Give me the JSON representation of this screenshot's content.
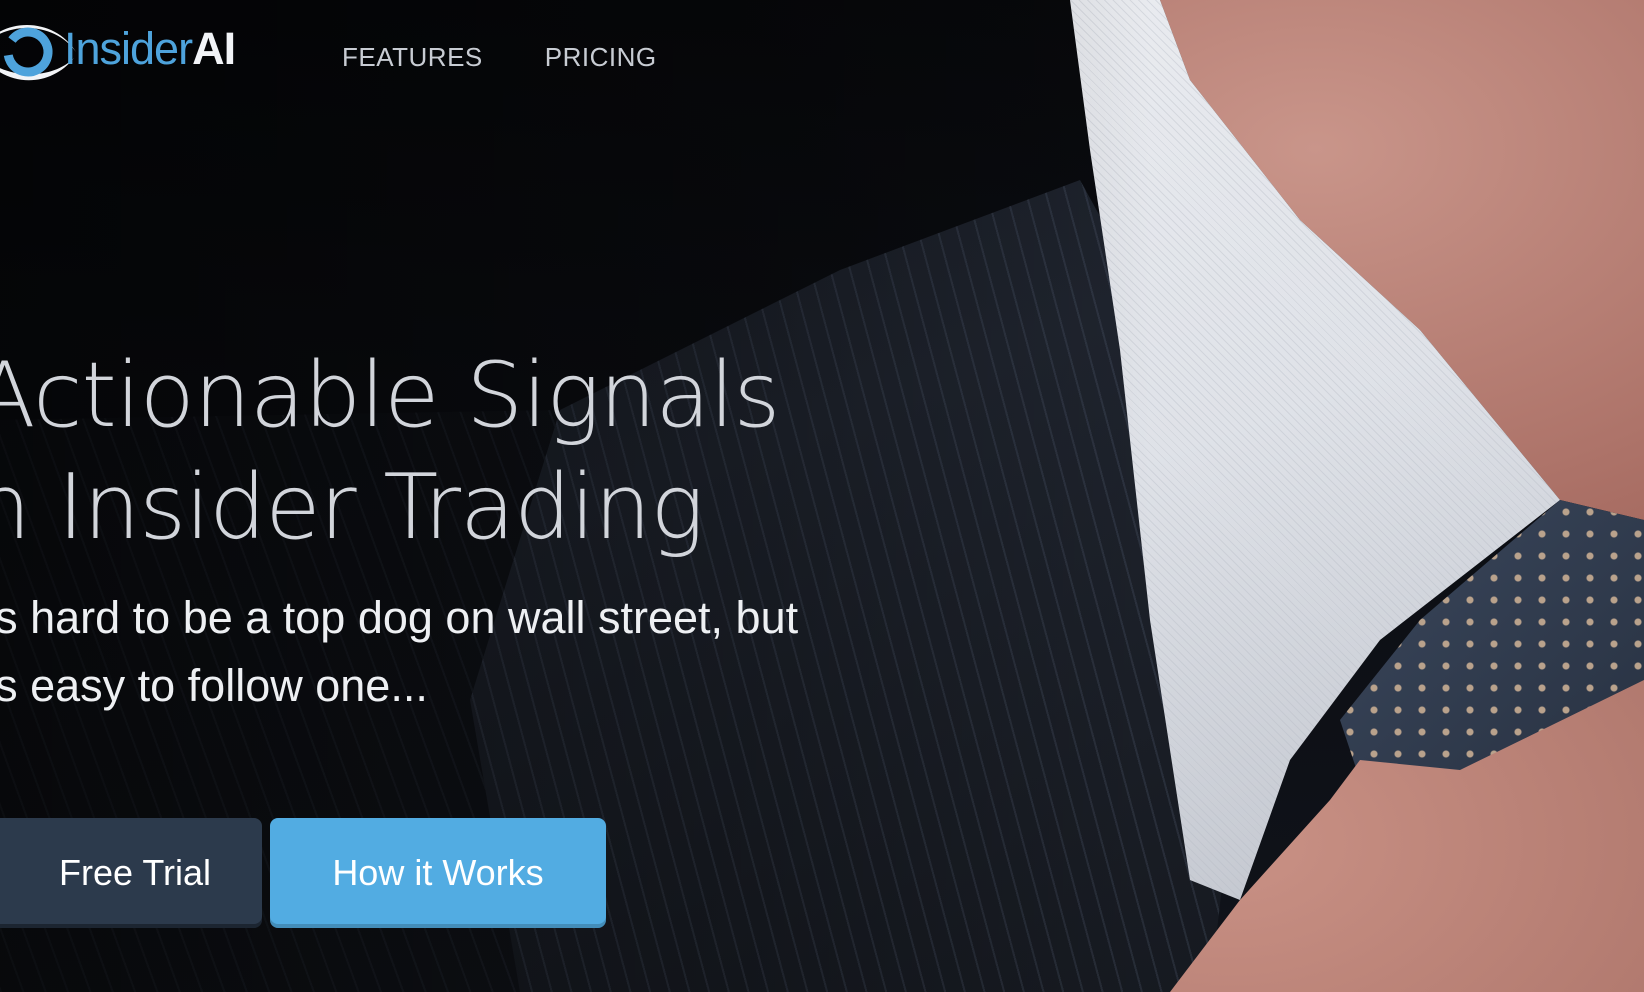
{
  "brand": {
    "name_part1": "Insider",
    "name_part2": "AI",
    "accent_color": "#4ea3dc"
  },
  "nav": {
    "items": [
      {
        "label": "FEATURES"
      },
      {
        "label": "PRICING"
      }
    ]
  },
  "hero": {
    "headline_line1": "Actionable Signals",
    "headline_line2": "n Insider Trading",
    "tagline_line1": "t's hard to be a top dog on wall street, but",
    "tagline_line2": "t's easy to follow one..."
  },
  "cta": {
    "free_trial_label": "Free Trial",
    "how_it_works_label": "How it Works",
    "free_trial_color": "#2c3a4c",
    "how_it_works_color": "#52ace2"
  },
  "icons": [
    "eye-logo-icon"
  ]
}
